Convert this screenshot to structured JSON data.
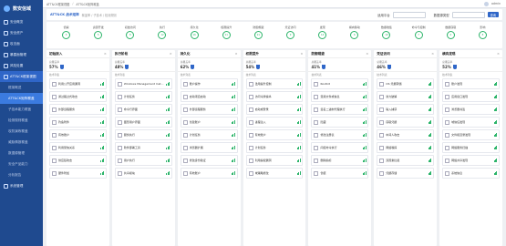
{
  "app": {
    "brand": "数安信域"
  },
  "sidebar": {
    "items": [
      {
        "label": "安全概览"
      },
      {
        "label": "安全资产"
      },
      {
        "label": "攻击面"
      },
      {
        "label": "暴露面管理"
      },
      {
        "label": "风险处置"
      },
      {
        "label": "ATT&CK框架视图"
      },
      {
        "label": "框架概述",
        "sub": true
      },
      {
        "label": "ATT&CK矩阵覆盖",
        "sub": true,
        "current": true
      },
      {
        "label": "子技术能力覆盖",
        "sub": true
      },
      {
        "label": "检测规则覆盖",
        "sub": true
      },
      {
        "label": "攻防演练覆盖",
        "sub": true
      },
      {
        "label": "威胁情报覆盖",
        "sub": true
      },
      {
        "label": "数据源管理",
        "sub": true
      },
      {
        "label": "安全产品能力",
        "sub": true
      },
      {
        "label": "分析报告",
        "sub": true
      },
      {
        "label": "系统管理"
      }
    ]
  },
  "topbar": {
    "crumbs": [
      "ATT&CK框架视图",
      "ATT&CK矩阵覆盖"
    ],
    "user": "admin"
  },
  "filter": {
    "title": "ATT&CK 战术矩阵",
    "subtitle": "覆盖率 / 子技术 / 检测规则",
    "f1": "适用平台",
    "f2": "数据源类型",
    "btn": "查询"
  },
  "tactics_stats": [
    {
      "label": "侦察",
      "val": "3"
    },
    {
      "label": "资源开发",
      "val": "5"
    },
    {
      "label": "初始访问",
      "val": "8"
    },
    {
      "label": "执行",
      "val": "12"
    },
    {
      "label": "持久化",
      "val": "16"
    },
    {
      "label": "权限提升",
      "val": "11"
    },
    {
      "label": "防御规避",
      "val": "21"
    },
    {
      "label": "凭证访问",
      "val": "9"
    },
    {
      "label": "发现",
      "val": "14"
    },
    {
      "label": "横向移动",
      "val": "6"
    },
    {
      "label": "数据收集",
      "val": "10"
    },
    {
      "label": "命令与控制",
      "val": "7"
    },
    {
      "label": "数据窃取",
      "val": "4"
    },
    {
      "label": "影响",
      "val": "8"
    }
  ],
  "columns": [
    {
      "title": "初始接入",
      "coverage_label": "总覆盖率",
      "coverage": "57%",
      "section": "技术列表",
      "cards": [
        "利用公开应用漏洞",
        "通过路过式攻击",
        "外部远程服务",
        "钓鱼附件",
        "有效账户",
        "利用受信关系",
        "供应链攻击",
        "硬件附加"
      ]
    },
    {
      "title": "执行阶段",
      "coverage_label": "总覆盖率",
      "coverage": "48%",
      "section": "技术列表",
      "cards": [
        "Windows Management Instrumentation",
        "计划任务",
        "命令行界面",
        "图形用户界面",
        "服务执行",
        "软件部署工具",
        "用户执行",
        "共享模块"
      ]
    },
    {
      "title": "持久化",
      "coverage_label": "总覆盖率",
      "coverage": "62%",
      "section": "技术列表",
      "cards": [
        "账户操作",
        "启动项自启动",
        "外部远程服务",
        "创建账户",
        "计划任务",
        "浏览器扩展",
        "修改身份验证",
        "有效账户"
      ]
    },
    {
      "title": "权限提升",
      "coverage_label": "总覆盖率",
      "coverage": "54%",
      "section": "技术列表",
      "cards": [
        "滥用提升控制",
        "访问令牌操纵",
        "启动或登录",
        "进程注入",
        "有效账户",
        "计划任务",
        "利用提权漏洞",
        "域策略修改"
      ]
    },
    {
      "title": "防御规避",
      "coverage_label": "总覆盖率",
      "coverage": "41%",
      "section": "技术列表",
      "cards": [
        "Rootkit",
        "混淆文件或信息",
        "签名二进制代理执行",
        "隐藏",
        "修改注册表",
        "间接命令执行",
        "删除指标",
        "伪装"
      ]
    },
    {
      "title": "凭证访问",
      "coverage_label": "总覆盖率",
      "coverage": "46%",
      "section": "技术列表",
      "cards": [
        "OS 凭据转储",
        "暴力破解",
        "输入捕获",
        "窃取凭据",
        "中间人攻击",
        "网络嗅探",
        "双因素拦截",
        "凭据存储"
      ]
    },
    {
      "title": "横向发现",
      "coverage_label": "总覆盖率",
      "coverage": "52%",
      "section": "技术列表",
      "cards": [
        "账户发现",
        "应用窗口发现",
        "浏览器书签",
        "域信任发现",
        "文件和目录发现",
        "网络服务扫描",
        "网络共享发现",
        "系统信息"
      ]
    }
  ]
}
